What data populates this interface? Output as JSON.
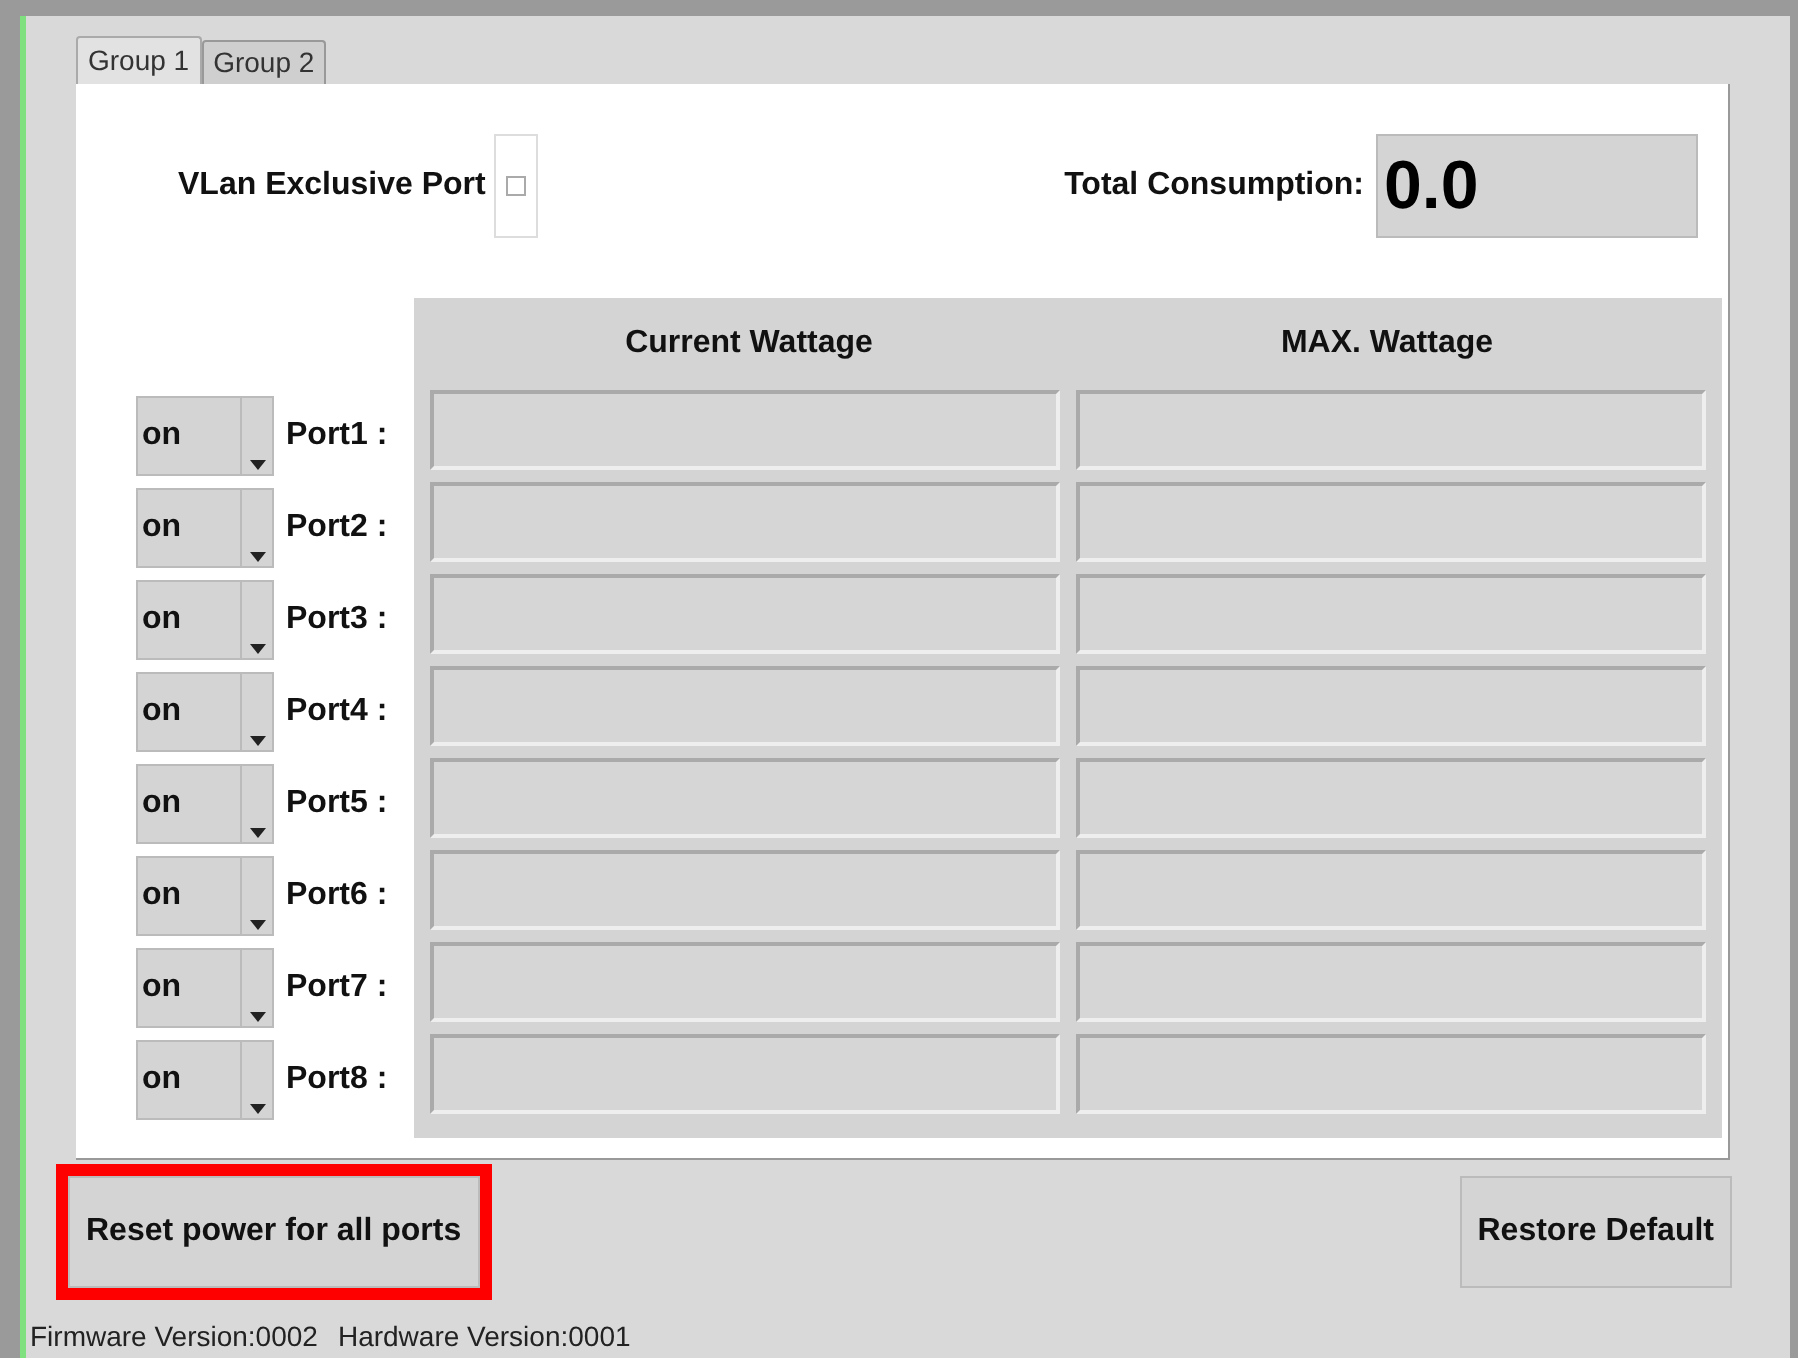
{
  "tabs": [
    {
      "label": "Group 1",
      "selected": true
    },
    {
      "label": "Group 2",
      "selected": false
    }
  ],
  "vlan": {
    "label": "VLan Exclusive Port",
    "checked": false
  },
  "total": {
    "label": "Total Consumption:",
    "value": "0.0"
  },
  "table": {
    "columns": [
      "Current Wattage",
      "MAX. Wattage"
    ],
    "rows": [
      {
        "state": "on",
        "label": "Port1 :"
      },
      {
        "state": "on",
        "label": "Port2 :"
      },
      {
        "state": "on",
        "label": "Port3 :"
      },
      {
        "state": "on",
        "label": "Port4 :"
      },
      {
        "state": "on",
        "label": "Port5 :"
      },
      {
        "state": "on",
        "label": "Port6 :"
      },
      {
        "state": "on",
        "label": "Port7 :"
      },
      {
        "state": "on",
        "label": "Port8 :"
      }
    ]
  },
  "buttons": [
    {
      "label": "Reset power for all ports",
      "highlighted": true
    },
    {
      "label": "Restore Default",
      "highlighted": false
    }
  ],
  "status_bar": [
    "Firmware Version:0002",
    "Hardware Version:0001"
  ]
}
